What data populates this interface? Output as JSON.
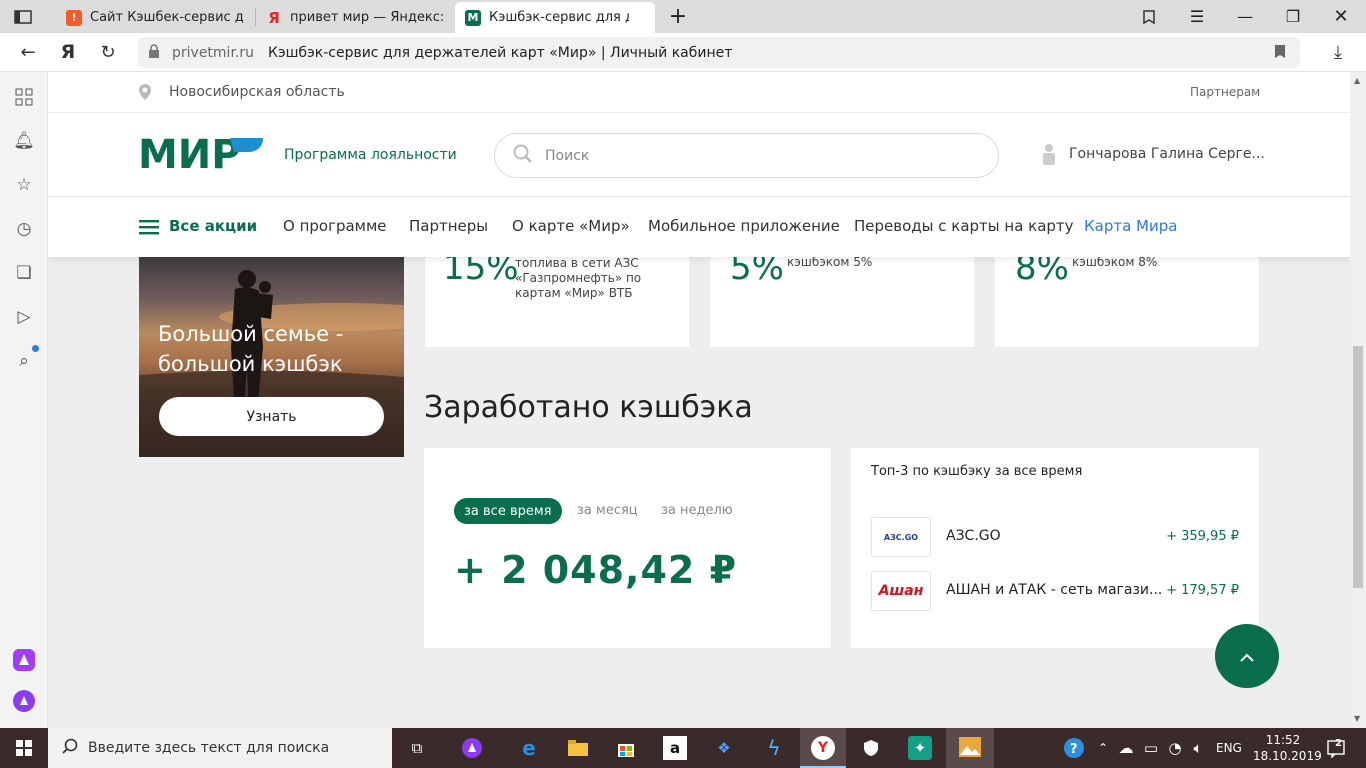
{
  "browser": {
    "tabs": [
      {
        "title": "Сайт Кэшбек-сервис для д",
        "favicon": "orange-badge-icon",
        "active": false
      },
      {
        "title": "привет мир — Яндекс: нац",
        "favicon": "yandex-icon",
        "active": false
      },
      {
        "title": "Кэшбэк-сервис для дер",
        "favicon": "mir-icon",
        "active": true
      }
    ],
    "url_host": "privetmir.ru",
    "url_title": "Кэшбэк-сервис для держателей карт «Мир» | Личный кабинет",
    "yandex_logo": "Я"
  },
  "site": {
    "region": "Новосибирская область",
    "partners_link": "Партнерам",
    "logo_text": "МИР",
    "program_label": "Программа лояльности",
    "search_placeholder": "Поиск",
    "user_name": "Гончарова Галина Серге...",
    "nav": {
      "all_offers": "Все акции",
      "items": [
        "О программе",
        "Партнеры",
        "О карте «Мир»",
        "Мобильное приложение",
        "Переводы с карты на карту",
        "Карта Мира"
      ]
    }
  },
  "offers": [
    {
      "percent": "15%",
      "desc": [
        "топлива в сети АЗС",
        "«Газпромнефть» по",
        "картам «Мир» ВТБ"
      ]
    },
    {
      "percent": "5%",
      "desc": [
        "кэшбэком 5%"
      ]
    },
    {
      "percent": "8%",
      "desc": [
        "кэшбэком 8%"
      ]
    }
  ],
  "promo": {
    "title": "Большой семье - большой кэшбэк",
    "button": "Узнать"
  },
  "earned": {
    "heading": "Заработано кэшбэка",
    "periods": [
      "за все время",
      "за месяц",
      "за неделю"
    ],
    "active_period": "за все время",
    "amount": "+ 2 048,42 ₽"
  },
  "top3": {
    "title": "Топ-3 по кэшбэку за все время",
    "items": [
      {
        "logo": "АЗС.GO",
        "name": "АЗС.GO",
        "amount": "+ 359,95 ₽"
      },
      {
        "logo": "Ашан",
        "name": "АШАН и АТАК - сеть магази...",
        "amount": "+ 179,57 ₽"
      }
    ]
  },
  "taskbar": {
    "search_placeholder": "Введите здесь текст для поиска",
    "lang": "ENG",
    "time": "11:52",
    "date": "18.10.2019",
    "notif_count": "2"
  },
  "colors": {
    "brand_green": "#0a6d4d",
    "link_blue": "#2a7ae2"
  }
}
